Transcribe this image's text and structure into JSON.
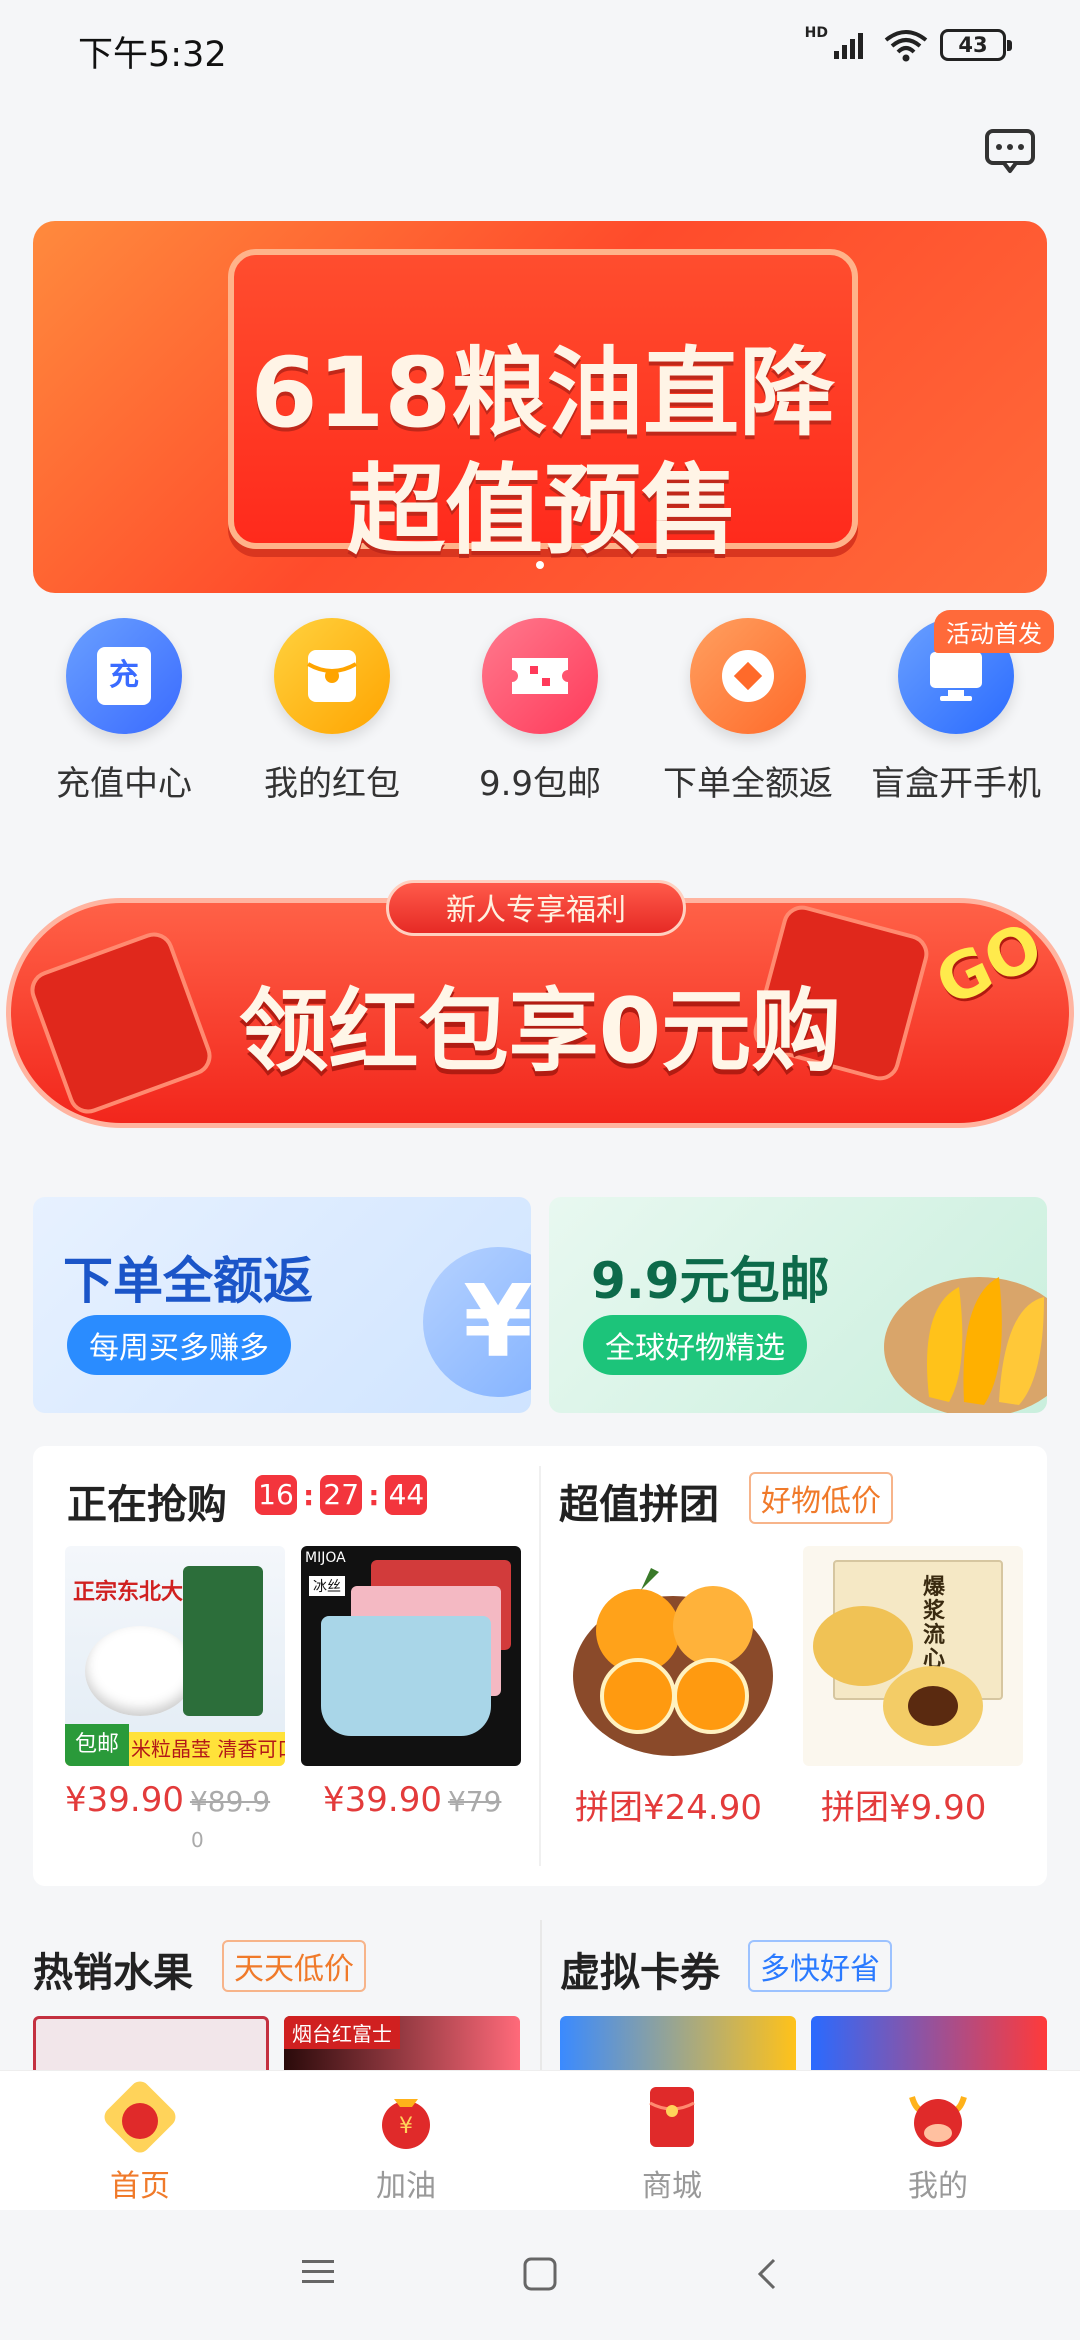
{
  "status": {
    "time": "下午5:32",
    "network": "HD",
    "battery": "43"
  },
  "banner": {
    "line1": "618粮油直降",
    "line2": "超值预售"
  },
  "quick_entries": [
    {
      "label": "充值中心",
      "icon": "recharge-icon",
      "glyph": "充",
      "color": "#4a7dff"
    },
    {
      "label": "我的红包",
      "icon": "red-packet-icon",
      "color": "#ffb21a"
    },
    {
      "label": "9.9包邮",
      "icon": "ticket-icon",
      "color": "#ff4f6b"
    },
    {
      "label": "下单全额返",
      "icon": "coin-return-icon",
      "color": "#ff7a3a"
    },
    {
      "label": "盲盒开手机",
      "icon": "monitor-icon",
      "color": "#3a7dff"
    }
  ],
  "activity_badge": "活动首发",
  "promo": {
    "tag": "新人专享福利",
    "title": "领红包享0元购",
    "go": "GO"
  },
  "feature_cards": {
    "fanli": {
      "title": "下单全额返",
      "pill": "每周买多赚多",
      "coin": "¥"
    },
    "baoyou": {
      "title": "9.9元包邮",
      "pill": "全球好物精选"
    }
  },
  "flash_sale": {
    "title": "正在抢购",
    "timer": [
      "16",
      "27",
      "44"
    ],
    "items": [
      {
        "price": "¥39.90",
        "orig": "¥89.9",
        "orig_tail": "0",
        "label": "正宗东北大米",
        "tag": "包邮",
        "sub": "米粒晶莹 清香可口"
      },
      {
        "price": "¥39.90",
        "orig": "¥79",
        "brand": "MIJOA",
        "sub": "冰丝"
      }
    ]
  },
  "group_buy": {
    "title": "超值拼团",
    "tag": "好物低价",
    "items": [
      {
        "price": "拼团¥24.90"
      },
      {
        "price": "拼团¥9.90",
        "label": "爆浆流心酥"
      }
    ]
  },
  "hot_fruit": {
    "title": "热销水果",
    "tag": "天天低价",
    "item_label": "烟台红富士"
  },
  "vouchers": {
    "title": "虚拟卡券",
    "tag": "多快好省"
  },
  "tabbar": [
    {
      "label": "首页",
      "active": true
    },
    {
      "label": "加油",
      "active": false
    },
    {
      "label": "商城",
      "active": false
    },
    {
      "label": "我的",
      "active": false
    }
  ]
}
